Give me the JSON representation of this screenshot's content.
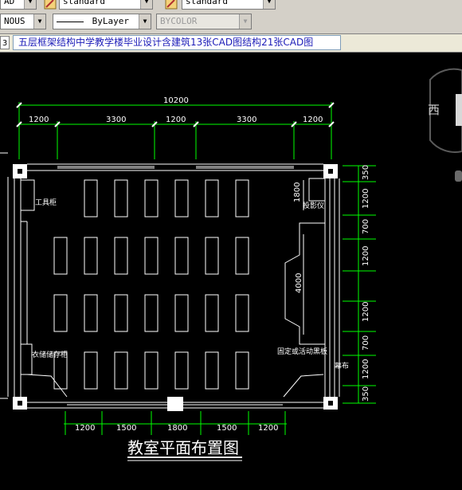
{
  "toolbar": {
    "combo_textstyle_left": "AD",
    "combo_textstyle": "standard",
    "combo_dimstyle": "standard",
    "combo_linetype_left": "NOUS",
    "combo_linetype": "ByLayer",
    "combo_color": "BYCOLOR"
  },
  "tabbar": {
    "tab_number": "3",
    "tab_title": "五层框架结构中学教学楼毕业设计含建筑13张CAD图结构21张CAD图"
  },
  "drawing": {
    "viewcube_label": "西",
    "total_width": "10200",
    "top_dims": [
      "1200",
      "3300",
      "1200",
      "3300",
      "1200"
    ],
    "bottom_dims": [
      "1200",
      "1500",
      "1800",
      "1500",
      "1200"
    ],
    "right_dims": [
      "350",
      "1200",
      "700",
      "1200",
      "1200",
      "700",
      "1200",
      "350"
    ],
    "inner_dim_1800": "1800",
    "inner_dim_4000": "4000",
    "label_tool_cabinet": "工具柜",
    "label_projector": "投影仪",
    "label_storage_cabinet": "衣储储存柜",
    "label_blackboard": "固定或活动黑板",
    "label_screen": "幕布",
    "title": "教室平面布置图"
  },
  "colors": {
    "cad_background": "#000000",
    "cad_line": "#ffffff",
    "dim_line": "#00ff00",
    "label_yellow": "#ffff00",
    "tab_text": "#1c1cb8"
  }
}
